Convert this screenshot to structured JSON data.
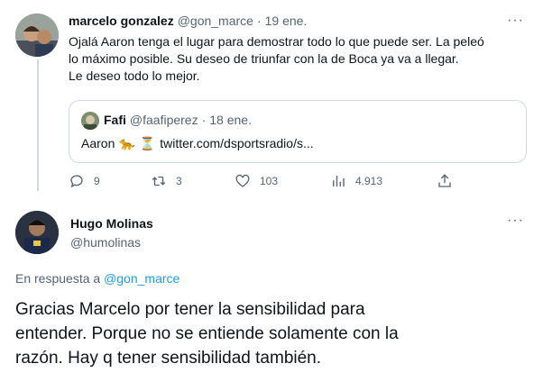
{
  "tweet1": {
    "author_name": "marcelo gonzalez",
    "handle": "@gon_marce",
    "separator": "·",
    "date": "19 ene.",
    "more": "···",
    "lines": [
      "Ojalá Aaron tenga el lugar para demostrar todo lo que puede ser. La peleó",
      "lo máximo posible. Su deseo de triunfar con la de Boca ya va a llegar.",
      "Le deseo todo lo mejor."
    ],
    "quote": {
      "author_name": "Fafi",
      "handle": "@faafiperez",
      "separator": "·",
      "date": "18 ene.",
      "text_prefix": "Aaron",
      "emoji_tiger": "🐆",
      "emoji_hourglass": "⏳",
      "link": "twitter.com/dsportsradio/s..."
    },
    "actions": {
      "replies": "9",
      "retweets": "3",
      "likes": "103",
      "views": "4.913"
    }
  },
  "tweet2": {
    "author_name": "Hugo Molinas",
    "handle": "@humolinas",
    "more": "···",
    "reply_prefix": "En respuesta a",
    "reply_to": "@gon_marce",
    "lines": [
      "Gracias Marcelo por tener la sensibilidad para",
      "entender. Porque no se entiende solamente con la",
      "razón. Hay q tener sensibilidad también."
    ]
  },
  "colors": {
    "text": "#0f1419",
    "muted": "#536471",
    "link": "#1d9bf0",
    "border": "#cfd9de"
  }
}
